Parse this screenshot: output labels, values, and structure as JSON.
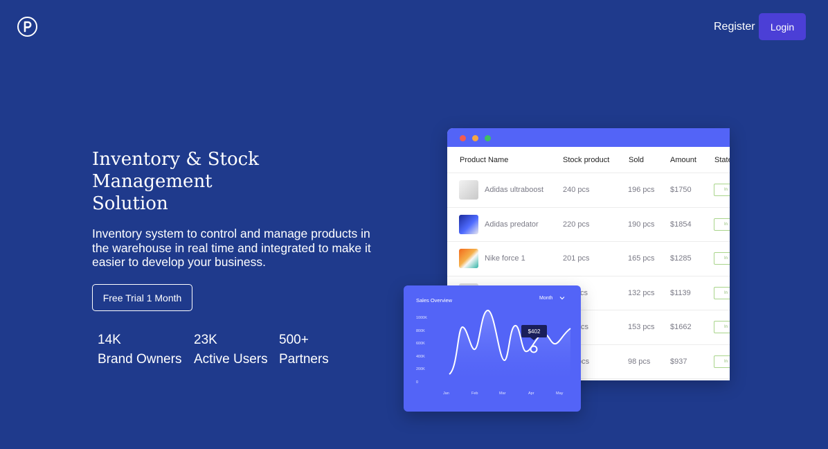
{
  "header": {
    "logo_icon": "p-logo-icon",
    "register_label": "Register",
    "login_label": "Login",
    "accent_color": "#4b3fd6"
  },
  "hero": {
    "title_line1": "Inventory & Stock",
    "title_line2": "Management",
    "title_line3": "Solution",
    "description": "Inventory system to control and manage products in the warehouse in real time and integrated to make it easier to develop your business.",
    "cta_label": "Free Trial 1 Month"
  },
  "stats": [
    {
      "value": "14K",
      "label": "Brand Owners"
    },
    {
      "value": "23K",
      "label": "Active Users"
    },
    {
      "value": "500+",
      "label": "Partners"
    }
  ],
  "table": {
    "columns": [
      "Product Name",
      "Stock product",
      "Sold",
      "Amount",
      "State"
    ],
    "rows": [
      {
        "name": "Adidas ultraboost",
        "stock": "240 pcs",
        "sold": "196 pcs",
        "amount": "$1750",
        "state": "In"
      },
      {
        "name": "Adidas predator",
        "stock": "220 pcs",
        "sold": "190 pcs",
        "amount": "$1854",
        "state": "In"
      },
      {
        "name": "Nike force 1",
        "stock": "201 pcs",
        "sold": "165 pcs",
        "amount": "$1285",
        "state": "In"
      },
      {
        "name": "",
        "stock": "cs",
        "sold": "132 pcs",
        "amount": "$1139",
        "state": "In"
      },
      {
        "name": "",
        "stock": "cs",
        "sold": "153 pcs",
        "amount": "$1662",
        "state": "In"
      },
      {
        "name": "",
        "stock": "pcs",
        "sold": "98 pcs",
        "amount": "$937",
        "state": "In"
      }
    ]
  },
  "sales": {
    "title": "Sales Overview",
    "filter": "Month",
    "tooltip": "$402",
    "y_ticks": [
      "1000K",
      "800K",
      "600K",
      "400K",
      "200K",
      "0"
    ],
    "x_ticks": [
      "Jan",
      "Feb",
      "Mar",
      "Apr",
      "May"
    ]
  }
}
